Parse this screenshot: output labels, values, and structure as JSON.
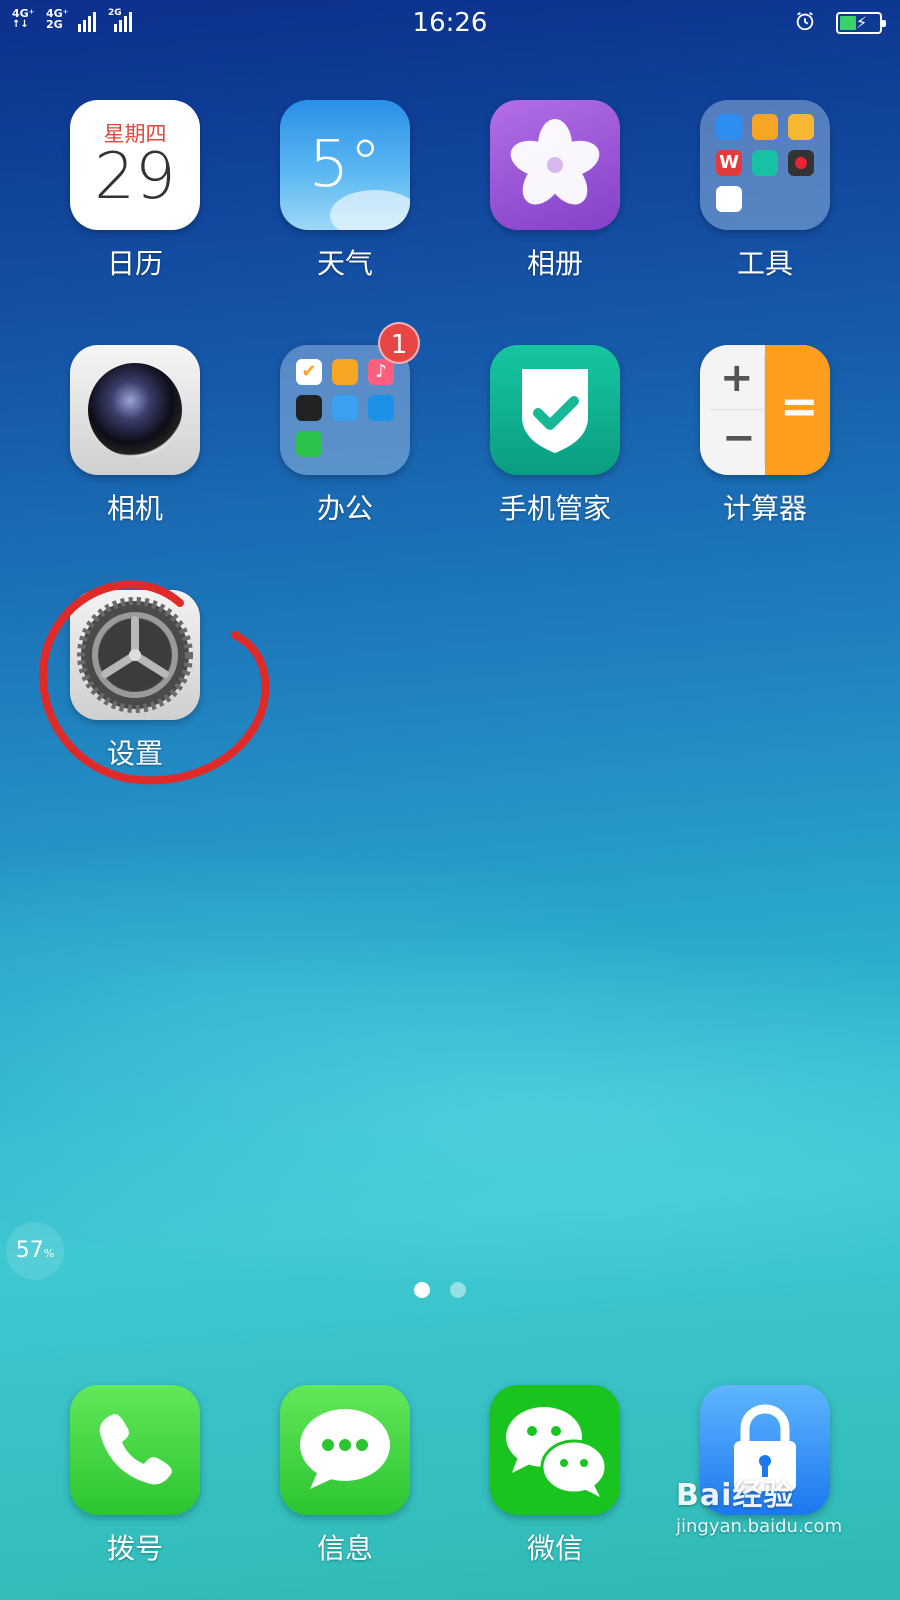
{
  "status_bar": {
    "network_1": "4G⁺",
    "network_2": "4G⁺",
    "network_3": "2G",
    "network_4": "2G",
    "time": "16:26",
    "icons": [
      "alarm-icon",
      "battery-charging-icon"
    ]
  },
  "apps": [
    {
      "label": "日历",
      "weekday": "星期四",
      "day": "29"
    },
    {
      "label": "天气",
      "temperature": "5°"
    },
    {
      "label": "相册"
    },
    {
      "label": "工具"
    },
    {
      "label": "相机"
    },
    {
      "label": "办公",
      "badge": "1"
    },
    {
      "label": "手机管家"
    },
    {
      "label": "计算器"
    },
    {
      "label": "设置"
    }
  ],
  "memory_widget": {
    "value": "57",
    "unit": "%"
  },
  "page_indicator": {
    "pages": 2,
    "active": 1
  },
  "dock": [
    {
      "label": "拨号"
    },
    {
      "label": "信息"
    },
    {
      "label": "微信"
    },
    {
      "label": ""
    }
  ],
  "watermark": {
    "logo": "Bai经验",
    "url": "jingyan.baidu.com"
  },
  "colors": {
    "badge": "#e84545",
    "annotation_circle": "#e02a2a"
  }
}
